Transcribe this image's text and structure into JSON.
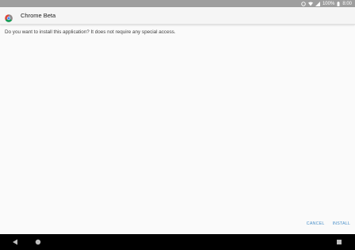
{
  "status_bar": {
    "battery_text": "100%",
    "time": "8:00",
    "icons": [
      "data-saver-icon",
      "wifi-icon",
      "signal-icon",
      "battery-icon"
    ]
  },
  "header": {
    "title": "Chrome Beta",
    "icon": "chrome-beta-icon"
  },
  "body": {
    "message": "Do you want to install this application? It does not require any special access."
  },
  "actions": {
    "cancel_label": "CANCEL",
    "install_label": "INSTALL"
  },
  "nav_bar": {
    "icons": [
      "back-icon",
      "home-icon",
      "recents-icon"
    ]
  },
  "colors": {
    "accent": "#4a90c9",
    "status_bar": "#9e9e9e",
    "nav_bar": "#000000",
    "background": "#fafafa"
  }
}
